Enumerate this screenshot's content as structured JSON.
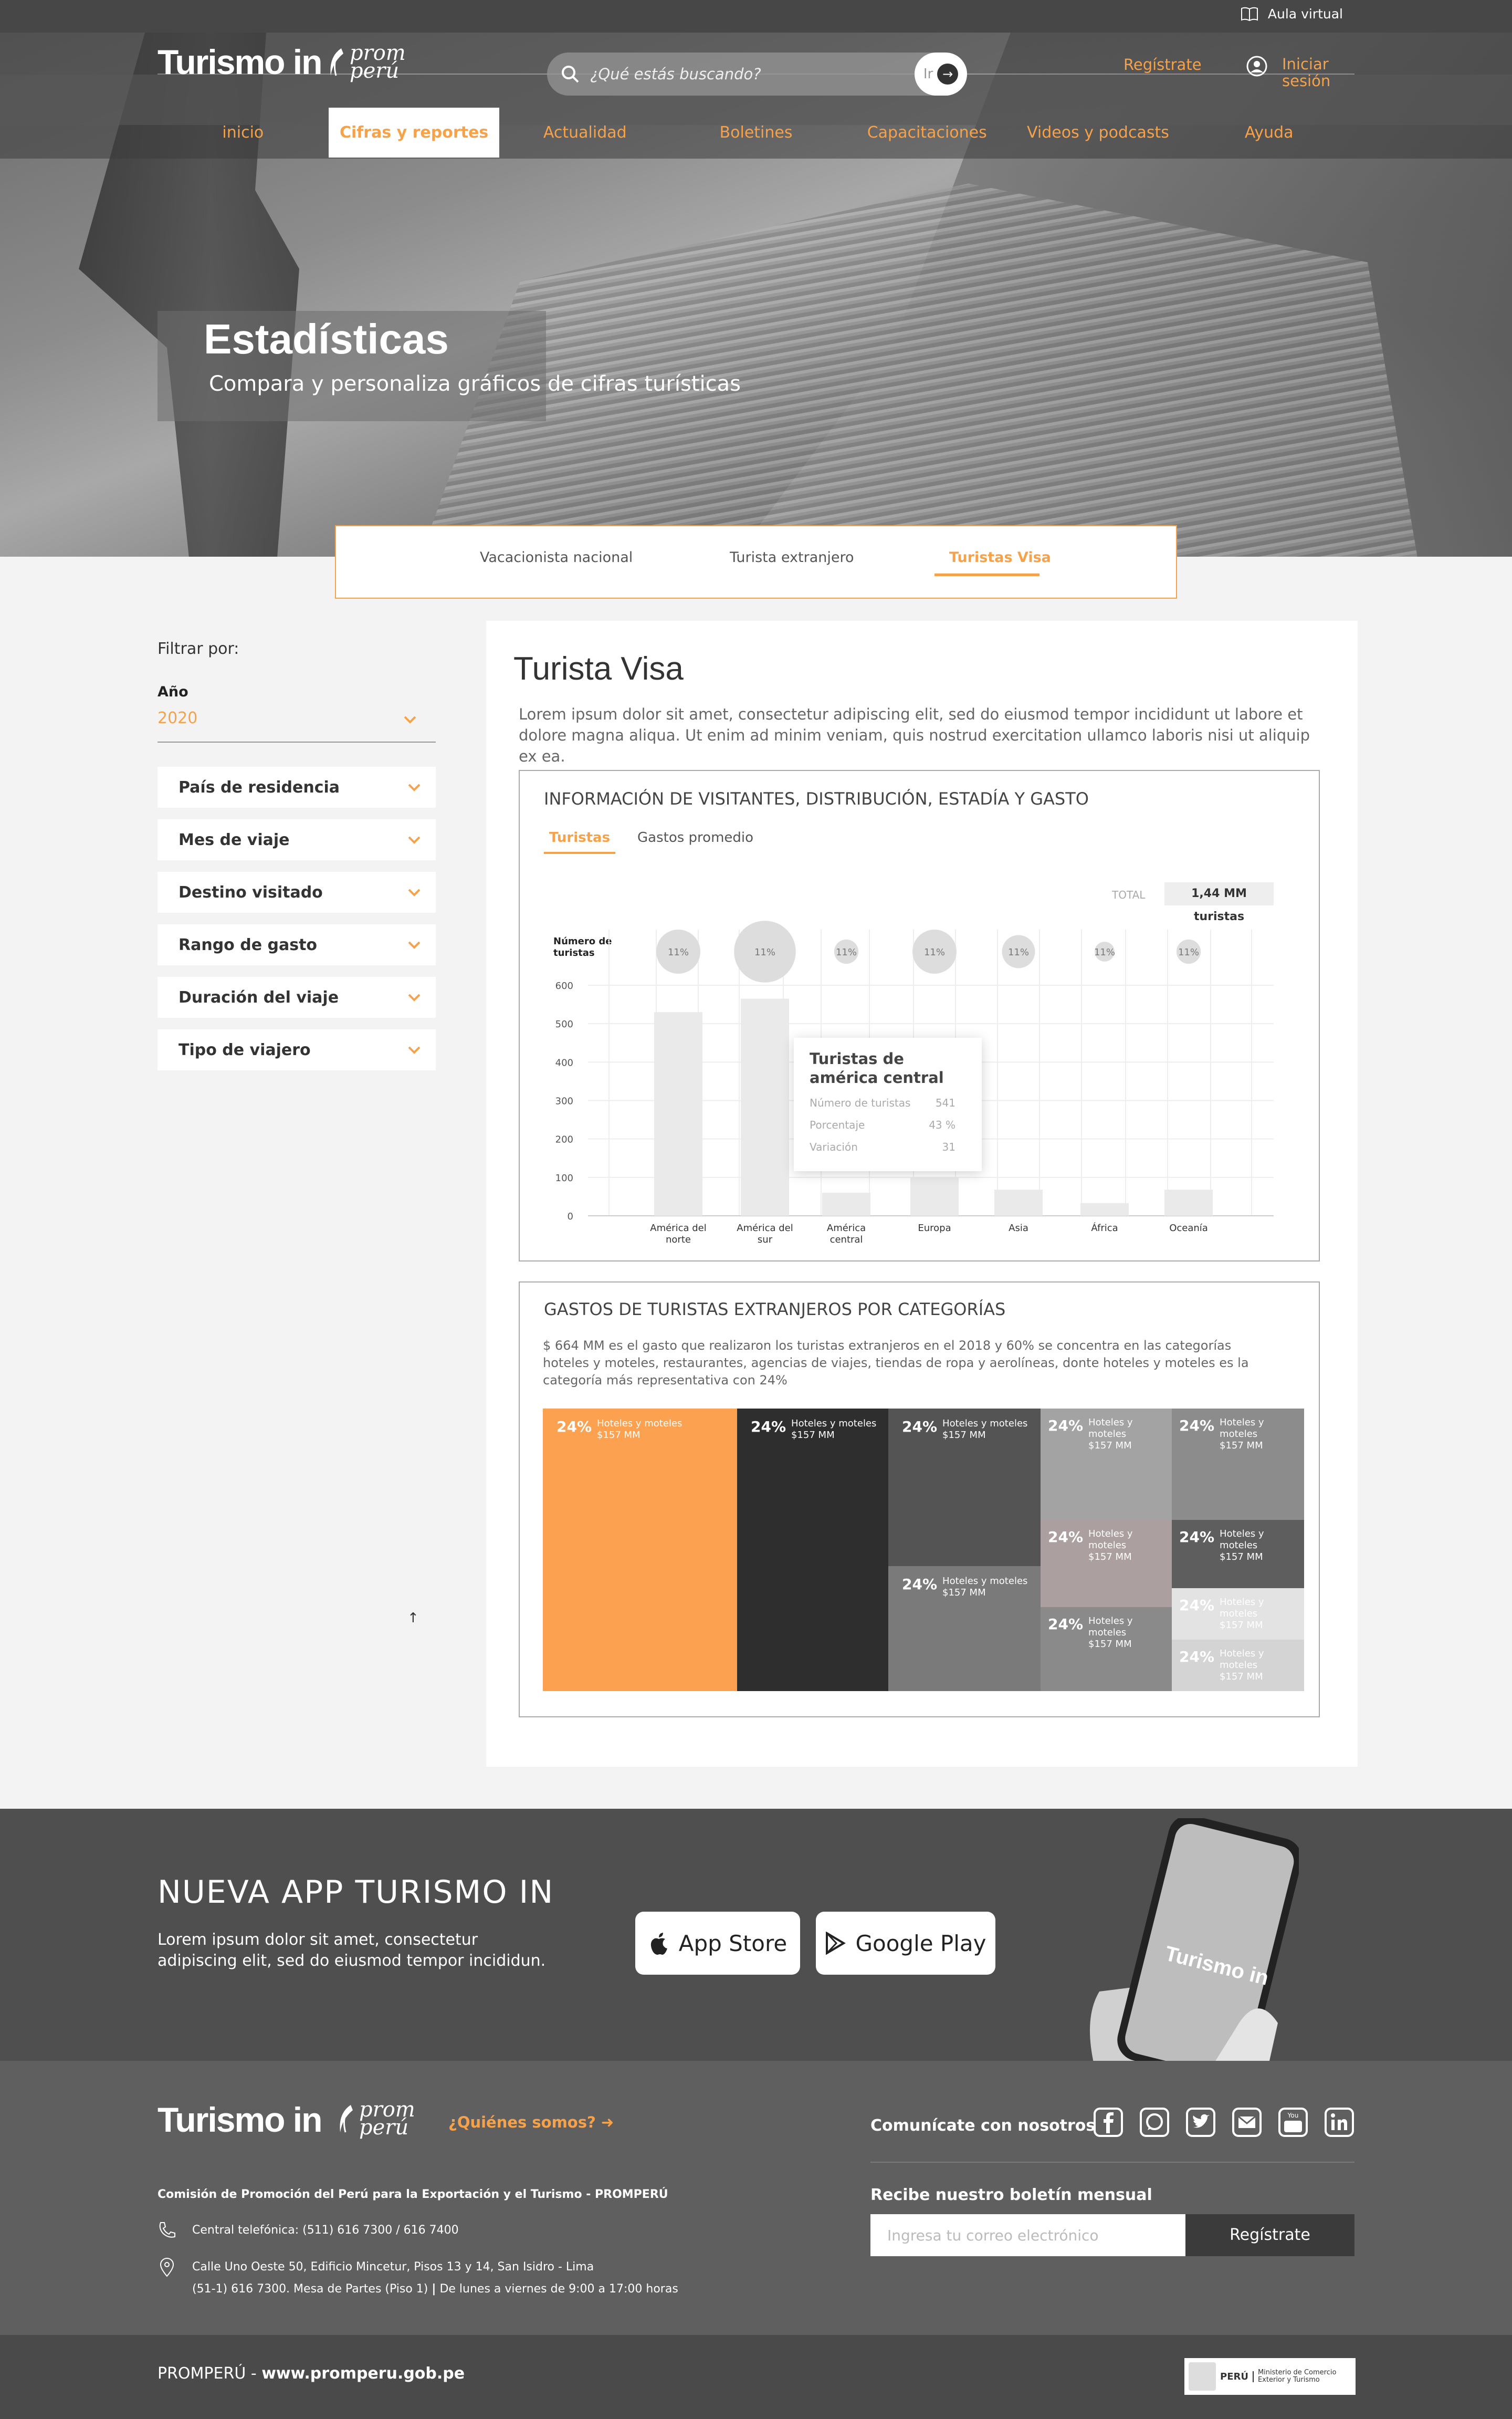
{
  "topbar": {
    "aula_label": "Aula virtual"
  },
  "header": {
    "logo_text": "Turismo in",
    "logo2_line1": "prom",
    "logo2_line2": "perú",
    "search_placeholder": "¿Qué estás buscando?",
    "search_go": "Ir",
    "register_label": "Regístrate",
    "login_line1": "Iniciar",
    "login_line2": "sesión"
  },
  "nav": {
    "items": [
      "inicio",
      "Cifras y reportes",
      "Actualidad",
      "Boletines",
      "Capacitaciones",
      "Videos y podcasts",
      "Ayuda"
    ],
    "active_index": 1
  },
  "hero": {
    "title": "Estadísticas",
    "subtitle": "Compara y personaliza gráficos  de cifras turísticas"
  },
  "tabs": {
    "items": [
      "Vacacionista nacional",
      "Turista extranjero",
      "Turistas Visa"
    ],
    "active_index": 2
  },
  "sidebar": {
    "filter_label": "Filtrar por:",
    "year_label": "Año",
    "year_value": "2020",
    "filters": [
      "País de residencia",
      "Mes de viaje",
      "Destino visitado",
      "Rango de gasto",
      "Duración del viaje",
      "Tipo de viajero"
    ],
    "up_arrow": "↑"
  },
  "main": {
    "title": "Turista Visa",
    "description": "Lorem ipsum dolor sit amet, consectetur adipiscing elit, sed do eiusmod tempor incididunt ut labore et dolore magna aliqua. Ut enim ad minim veniam, quis nostrud exercitation ullamco laboris nisi ut aliquip ex ea."
  },
  "panel1": {
    "title": "INFORMACIÓN DE VISITANTES, DISTRIBUCIÓN, ESTADÍA Y GASTO",
    "tab_active": "Turistas",
    "tab_other": "Gastos promedio",
    "total_label": "TOTAL",
    "total_value": "1,44 MM turistas",
    "tooltip": {
      "title": "Turistas de américa central",
      "rows": [
        {
          "label": "Número de turistas",
          "value": "541"
        },
        {
          "label": "Porcentaje",
          "value": "43 %"
        },
        {
          "label": "Variación",
          "value": "31"
        }
      ]
    }
  },
  "chart_data": {
    "type": "bar",
    "ylabel": "Número de turistas",
    "ylim": [
      0,
      600
    ],
    "yticks": [
      0,
      100,
      200,
      300,
      400,
      500,
      600
    ],
    "categories": [
      "América del norte",
      "América del sur",
      "América central",
      "Europa",
      "Asia",
      "África",
      "Oceanía"
    ],
    "values": [
      530,
      565,
      60,
      100,
      68,
      33,
      68
    ],
    "bubble_labels": [
      "11%",
      "11%",
      "11%",
      "11%",
      "11%",
      "11%",
      "11%"
    ],
    "bubble_sizes": [
      1.0,
      1.4,
      0.55,
      1.0,
      0.75,
      0.45,
      0.55
    ],
    "bar_color": "#eaeaea",
    "grid": true
  },
  "panel2": {
    "title": "GASTOS DE TURISTAS EXTRANJEROS POR CATEGORÍAS",
    "description": "$ 664 MM es el gasto que realizaron los turistas extranjeros en el 2018 y 60% se concentra en las categorías hoteles y moteles, restaurantes, agencias de viajes, tiendas de ropa y aerolíneas, donte hoteles y moteles es la categoría más representativa con 24%",
    "treemap": [
      {
        "pct": "24%",
        "label": "Hoteles y moteles",
        "amount": "$157 MM",
        "color": "#fba14f"
      },
      {
        "pct": "24%",
        "label": "Hoteles y moteles",
        "amount": "$157 MM",
        "color": "#2e2e2e"
      },
      {
        "pct": "24%",
        "label": "Hoteles y moteles",
        "amount": "$157 MM",
        "color": "#545454"
      },
      {
        "pct": "24%",
        "label": "Hoteles y moteles",
        "amount": "$157 MM",
        "color": "#7a7a7a"
      },
      {
        "pct": "24%",
        "label": "Hoteles y moteles",
        "amount": "$157 MM",
        "color": "#a3a3a3"
      },
      {
        "pct": "24%",
        "label": "Hoteles y moteles",
        "amount": "$157 MM",
        "color": "#ab9f9f"
      },
      {
        "pct": "24%",
        "label": "Hoteles y moteles",
        "amount": "$157 MM",
        "color": "#8a8a8a"
      },
      {
        "pct": "24%",
        "label": "Hoteles y moteles",
        "amount": "$157 MM",
        "color": "#8c8c8c"
      },
      {
        "pct": "24%",
        "label": "Hoteles y moteles",
        "amount": "$157 MM",
        "color": "#5e5e5e"
      },
      {
        "pct": "24%",
        "label": "Hoteles y moteles",
        "amount": "$157 MM",
        "color": "#e3e3e3"
      },
      {
        "pct": "24%",
        "label": "Hoteles y moteles",
        "amount": "$157 MM",
        "color": "#d4d4d4"
      }
    ]
  },
  "app": {
    "title": "NUEVA APP TURISMO IN",
    "description": "Lorem ipsum dolor sit amet, consectetur adipiscing elit, sed do eiusmod tempor incididun.",
    "app_store": "App Store",
    "google_play": "Google Play"
  },
  "footer": {
    "quienes": "¿Quiénes somos?",
    "comunicate": "Comunícate con nosotros",
    "comision": "Comisión de Promoción del Perú para la Exportación y el Turismo - PROMPERÚ",
    "telefono": "Central telefónica: (511) 616 7300 / 616 7400",
    "direccion1": "Calle Uno Oeste 50, Edificio Mincetur, Pisos 13 y 14, San Isidro - Lima",
    "direccion2": "(51-1) 616 7300. Mesa de Partes (Piso 1)",
    "direccion2b": "De lunes a viernes de 9:00 a 17:00 horas",
    "boletin": "Recibe nuestro boletín mensual",
    "email_placeholder": "Ingresa tu correo electrónico",
    "subscribe": "Regístrate",
    "bottom_prefix": "PROMPERÚ - ",
    "bottom_site": "www.promperu.gob.pe",
    "mincetur_peru": "PERÚ",
    "mincetur_text": "Ministerio de Comercio Exterior y Turismo"
  },
  "colors": {
    "accent": "#f5a24a",
    "dark": "#4f4f4f"
  }
}
